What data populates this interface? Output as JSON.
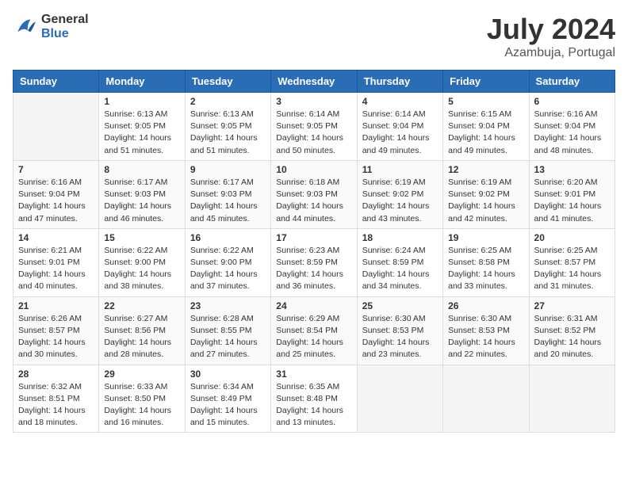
{
  "header": {
    "logo_line1": "General",
    "logo_line2": "Blue",
    "month_year": "July 2024",
    "location": "Azambuja, Portugal"
  },
  "weekdays": [
    "Sunday",
    "Monday",
    "Tuesday",
    "Wednesday",
    "Thursday",
    "Friday",
    "Saturday"
  ],
  "weeks": [
    [
      {
        "day": "",
        "info": ""
      },
      {
        "day": "1",
        "info": "Sunrise: 6:13 AM\nSunset: 9:05 PM\nDaylight: 14 hours\nand 51 minutes."
      },
      {
        "day": "2",
        "info": "Sunrise: 6:13 AM\nSunset: 9:05 PM\nDaylight: 14 hours\nand 51 minutes."
      },
      {
        "day": "3",
        "info": "Sunrise: 6:14 AM\nSunset: 9:05 PM\nDaylight: 14 hours\nand 50 minutes."
      },
      {
        "day": "4",
        "info": "Sunrise: 6:14 AM\nSunset: 9:04 PM\nDaylight: 14 hours\nand 49 minutes."
      },
      {
        "day": "5",
        "info": "Sunrise: 6:15 AM\nSunset: 9:04 PM\nDaylight: 14 hours\nand 49 minutes."
      },
      {
        "day": "6",
        "info": "Sunrise: 6:16 AM\nSunset: 9:04 PM\nDaylight: 14 hours\nand 48 minutes."
      }
    ],
    [
      {
        "day": "7",
        "info": "Sunrise: 6:16 AM\nSunset: 9:04 PM\nDaylight: 14 hours\nand 47 minutes."
      },
      {
        "day": "8",
        "info": "Sunrise: 6:17 AM\nSunset: 9:03 PM\nDaylight: 14 hours\nand 46 minutes."
      },
      {
        "day": "9",
        "info": "Sunrise: 6:17 AM\nSunset: 9:03 PM\nDaylight: 14 hours\nand 45 minutes."
      },
      {
        "day": "10",
        "info": "Sunrise: 6:18 AM\nSunset: 9:03 PM\nDaylight: 14 hours\nand 44 minutes."
      },
      {
        "day": "11",
        "info": "Sunrise: 6:19 AM\nSunset: 9:02 PM\nDaylight: 14 hours\nand 43 minutes."
      },
      {
        "day": "12",
        "info": "Sunrise: 6:19 AM\nSunset: 9:02 PM\nDaylight: 14 hours\nand 42 minutes."
      },
      {
        "day": "13",
        "info": "Sunrise: 6:20 AM\nSunset: 9:01 PM\nDaylight: 14 hours\nand 41 minutes."
      }
    ],
    [
      {
        "day": "14",
        "info": "Sunrise: 6:21 AM\nSunset: 9:01 PM\nDaylight: 14 hours\nand 40 minutes."
      },
      {
        "day": "15",
        "info": "Sunrise: 6:22 AM\nSunset: 9:00 PM\nDaylight: 14 hours\nand 38 minutes."
      },
      {
        "day": "16",
        "info": "Sunrise: 6:22 AM\nSunset: 9:00 PM\nDaylight: 14 hours\nand 37 minutes."
      },
      {
        "day": "17",
        "info": "Sunrise: 6:23 AM\nSunset: 8:59 PM\nDaylight: 14 hours\nand 36 minutes."
      },
      {
        "day": "18",
        "info": "Sunrise: 6:24 AM\nSunset: 8:59 PM\nDaylight: 14 hours\nand 34 minutes."
      },
      {
        "day": "19",
        "info": "Sunrise: 6:25 AM\nSunset: 8:58 PM\nDaylight: 14 hours\nand 33 minutes."
      },
      {
        "day": "20",
        "info": "Sunrise: 6:25 AM\nSunset: 8:57 PM\nDaylight: 14 hours\nand 31 minutes."
      }
    ],
    [
      {
        "day": "21",
        "info": "Sunrise: 6:26 AM\nSunset: 8:57 PM\nDaylight: 14 hours\nand 30 minutes."
      },
      {
        "day": "22",
        "info": "Sunrise: 6:27 AM\nSunset: 8:56 PM\nDaylight: 14 hours\nand 28 minutes."
      },
      {
        "day": "23",
        "info": "Sunrise: 6:28 AM\nSunset: 8:55 PM\nDaylight: 14 hours\nand 27 minutes."
      },
      {
        "day": "24",
        "info": "Sunrise: 6:29 AM\nSunset: 8:54 PM\nDaylight: 14 hours\nand 25 minutes."
      },
      {
        "day": "25",
        "info": "Sunrise: 6:30 AM\nSunset: 8:53 PM\nDaylight: 14 hours\nand 23 minutes."
      },
      {
        "day": "26",
        "info": "Sunrise: 6:30 AM\nSunset: 8:53 PM\nDaylight: 14 hours\nand 22 minutes."
      },
      {
        "day": "27",
        "info": "Sunrise: 6:31 AM\nSunset: 8:52 PM\nDaylight: 14 hours\nand 20 minutes."
      }
    ],
    [
      {
        "day": "28",
        "info": "Sunrise: 6:32 AM\nSunset: 8:51 PM\nDaylight: 14 hours\nand 18 minutes."
      },
      {
        "day": "29",
        "info": "Sunrise: 6:33 AM\nSunset: 8:50 PM\nDaylight: 14 hours\nand 16 minutes."
      },
      {
        "day": "30",
        "info": "Sunrise: 6:34 AM\nSunset: 8:49 PM\nDaylight: 14 hours\nand 15 minutes."
      },
      {
        "day": "31",
        "info": "Sunrise: 6:35 AM\nSunset: 8:48 PM\nDaylight: 14 hours\nand 13 minutes."
      },
      {
        "day": "",
        "info": ""
      },
      {
        "day": "",
        "info": ""
      },
      {
        "day": "",
        "info": ""
      }
    ]
  ]
}
